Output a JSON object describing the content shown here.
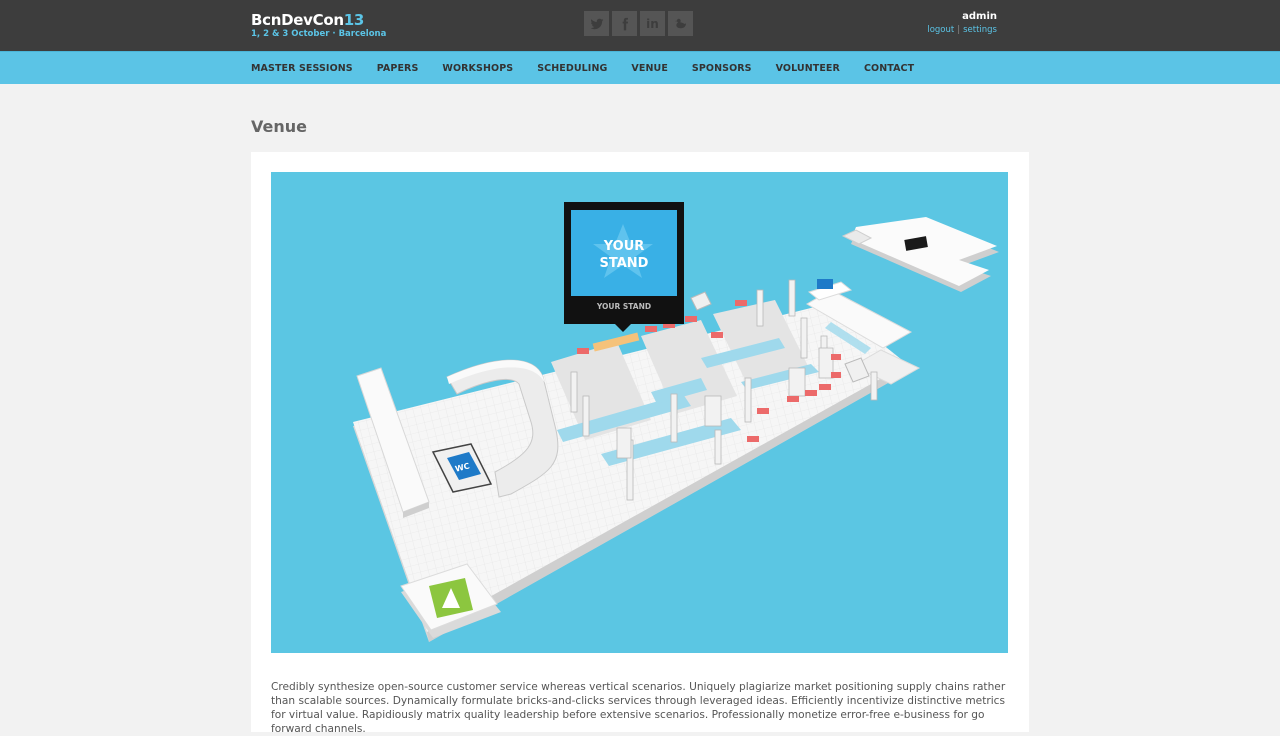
{
  "header": {
    "logo_text": "BcnDevCon",
    "logo_number": "13",
    "logo_subtitle": "1, 2 & 3 October · Barcelona",
    "social": [
      "twitter-icon",
      "facebook-icon",
      "linkedin-icon",
      "duck-icon"
    ],
    "social_labels": {
      "linkedin": "in"
    },
    "user": {
      "name": "admin",
      "logout_label": "logout",
      "separator": "|",
      "settings_label": "settings"
    }
  },
  "nav": {
    "items": [
      {
        "label": "MASTER SESSIONS"
      },
      {
        "label": "PAPERS"
      },
      {
        "label": "WORKSHOPS"
      },
      {
        "label": "SCHEDULING"
      },
      {
        "label": "VENUE"
      },
      {
        "label": "SPONSORS"
      },
      {
        "label": "VOLUNTEER"
      },
      {
        "label": "CONTACT"
      }
    ]
  },
  "main": {
    "title": "Venue",
    "map": {
      "popup_line1": "YOUR",
      "popup_line2": "STAND",
      "popup_caption": "YOUR STAND",
      "wc_label": "WC",
      "colors": {
        "water": "#5bc6e3",
        "floor": "#f4f4f4",
        "stand_available": "#ec6a6a",
        "stand_selected": "#f5c27a",
        "popup_bg": "#111111",
        "popup_screen": "#39b0e6",
        "wc_badge": "#1e7ac8",
        "entrance_badge": "#8cc63f"
      }
    },
    "body_text": "Credibly synthesize open-source customer service whereas vertical scenarios. Uniquely plagiarize market positioning supply chains rather than scalable sources. Dynamically formulate bricks-and-clicks services through leveraged ideas. Efficiently incentivize distinctive metrics for virtual value. Rapidiously matrix quality leadership before extensive scenarios. Professionally monetize error-free e-business for go forward channels."
  }
}
